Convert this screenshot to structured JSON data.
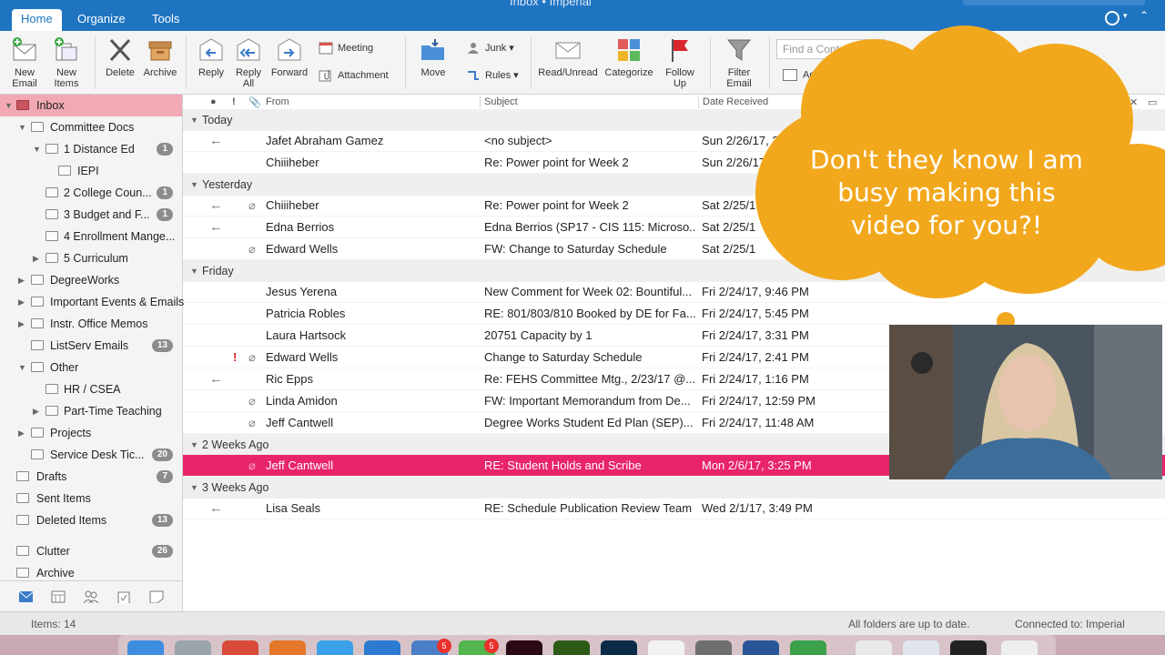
{
  "window": {
    "title": "Inbox • Imperial",
    "search_placeholder": "Search"
  },
  "tabs": [
    "Home",
    "Organize",
    "Tools"
  ],
  "ribbon": {
    "new_email": "New Email",
    "new_items": "New Items",
    "delete": "Delete",
    "archive": "Archive",
    "reply": "Reply",
    "reply_all": "Reply All",
    "forward": "Forward",
    "meeting": "Meeting",
    "attachment": "Attachment",
    "move": "Move",
    "junk": "Junk",
    "rules": "Rules",
    "read_unread": "Read/Unread",
    "categorize": "Categorize",
    "follow_up": "Follow Up",
    "filter_email": "Filter Email",
    "find_contact_placeholder": "Find a Conta",
    "address_book": "Add"
  },
  "sidebar": {
    "items": [
      {
        "label": "Inbox",
        "indent": 0,
        "count": ""
      },
      {
        "label": "Committee Docs",
        "indent": 1,
        "count": ""
      },
      {
        "label": "1 Distance Ed",
        "indent": 2,
        "count": "1"
      },
      {
        "label": "IEPI",
        "indent": 3,
        "count": ""
      },
      {
        "label": "2 College Coun...",
        "indent": 2,
        "count": "1"
      },
      {
        "label": "3 Budget and F...",
        "indent": 2,
        "count": "1"
      },
      {
        "label": "4 Enrollment Mange...",
        "indent": 2,
        "count": ""
      },
      {
        "label": "5 Curriculum",
        "indent": 2,
        "count": ""
      },
      {
        "label": "DegreeWorks",
        "indent": 1,
        "count": ""
      },
      {
        "label": "Important Events & Emails",
        "indent": 1,
        "count": ""
      },
      {
        "label": "Instr. Office Memos",
        "indent": 1,
        "count": ""
      },
      {
        "label": "ListServ Emails",
        "indent": 1,
        "count": "13"
      },
      {
        "label": "Other",
        "indent": 1,
        "count": ""
      },
      {
        "label": "HR / CSEA",
        "indent": 2,
        "count": ""
      },
      {
        "label": "Part-Time Teaching",
        "indent": 2,
        "count": ""
      },
      {
        "label": "Projects",
        "indent": 1,
        "count": ""
      },
      {
        "label": "Service Desk Tic...",
        "indent": 1,
        "count": "20"
      },
      {
        "label": "Drafts",
        "indent": 0,
        "count": "7"
      },
      {
        "label": "Sent Items",
        "indent": 0,
        "count": ""
      },
      {
        "label": "Deleted Items",
        "indent": 0,
        "count": "13"
      },
      {
        "label": "Clutter",
        "indent": 0,
        "count": "26"
      },
      {
        "label": "Archive",
        "indent": 0,
        "count": ""
      }
    ]
  },
  "columns": {
    "from": "From",
    "subject": "Subject",
    "date": "Date Received"
  },
  "groups": [
    {
      "label": "Today"
    },
    {
      "label": "Yesterday"
    },
    {
      "label": "Friday"
    },
    {
      "label": "2 Weeks Ago"
    },
    {
      "label": "3 Weeks Ago"
    }
  ],
  "messages": [
    {
      "from": "Jafet Abraham Gamez",
      "subject": "<no subject>",
      "date": "Sun 2/26/17, 3:08"
    },
    {
      "from": "Chiiiheber",
      "subject": "Re: Power point for Week 2",
      "date": "Sun 2/26/17, 12:"
    },
    {
      "from": "Chiiiheber",
      "subject": "Re: Power point for Week 2",
      "date": "Sat 2/25/1"
    },
    {
      "from": "Edna Berrios",
      "subject": "Edna Berrios (SP17 - CIS 115: Microso...",
      "date": "Sat 2/25/1"
    },
    {
      "from": "Edward Wells",
      "subject": "FW: Change to Saturday Schedule",
      "date": "Sat 2/25/1"
    },
    {
      "from": "Jesus Yerena",
      "subject": "New Comment for Week 02: Bountiful...",
      "date": "Fri 2/24/17, 9:46 PM"
    },
    {
      "from": "Patricia Robles",
      "subject": "RE: 801/803/810 Booked by DE for Fa...",
      "date": "Fri 2/24/17, 5:45 PM"
    },
    {
      "from": "Laura Hartsock",
      "subject": "20751 Capacity by 1",
      "date": "Fri 2/24/17, 3:31 PM"
    },
    {
      "from": "Edward Wells",
      "subject": "Change to Saturday Schedule",
      "date": "Fri 2/24/17, 2:41 PM"
    },
    {
      "from": "Ric Epps",
      "subject": "Re: FEHS Committee Mtg., 2/23/17 @...",
      "date": "Fri 2/24/17, 1:16 PM"
    },
    {
      "from": "Linda Amidon",
      "subject": "FW: Important Memorandum from De...",
      "date": "Fri 2/24/17, 12:59 PM"
    },
    {
      "from": "Jeff Cantwell",
      "subject": "Degree Works Student Ed Plan (SEP)...",
      "date": "Fri 2/24/17, 11:48 AM"
    },
    {
      "from": "Jeff Cantwell",
      "subject": "RE: Student Holds and Scribe",
      "date": "Mon 2/6/17, 3:25 PM"
    },
    {
      "from": "Lisa Seals",
      "subject": "RE: Schedule Publication Review Team",
      "date": "Wed 2/1/17, 3:49 PM"
    }
  ],
  "status": {
    "items": "Items: 14",
    "sync": "All folders are up to date.",
    "connected": "Connected to: Imperial"
  },
  "overlay": {
    "cloud_text": "Don't they know I am busy making this video for you?!"
  },
  "dock_badges": [
    "5",
    "5"
  ],
  "colors": {
    "accent": "#1f74c2",
    "selection": "#e8246a",
    "sidebar_selected": "#f2a9b4",
    "cloud": "#f2a81d"
  }
}
